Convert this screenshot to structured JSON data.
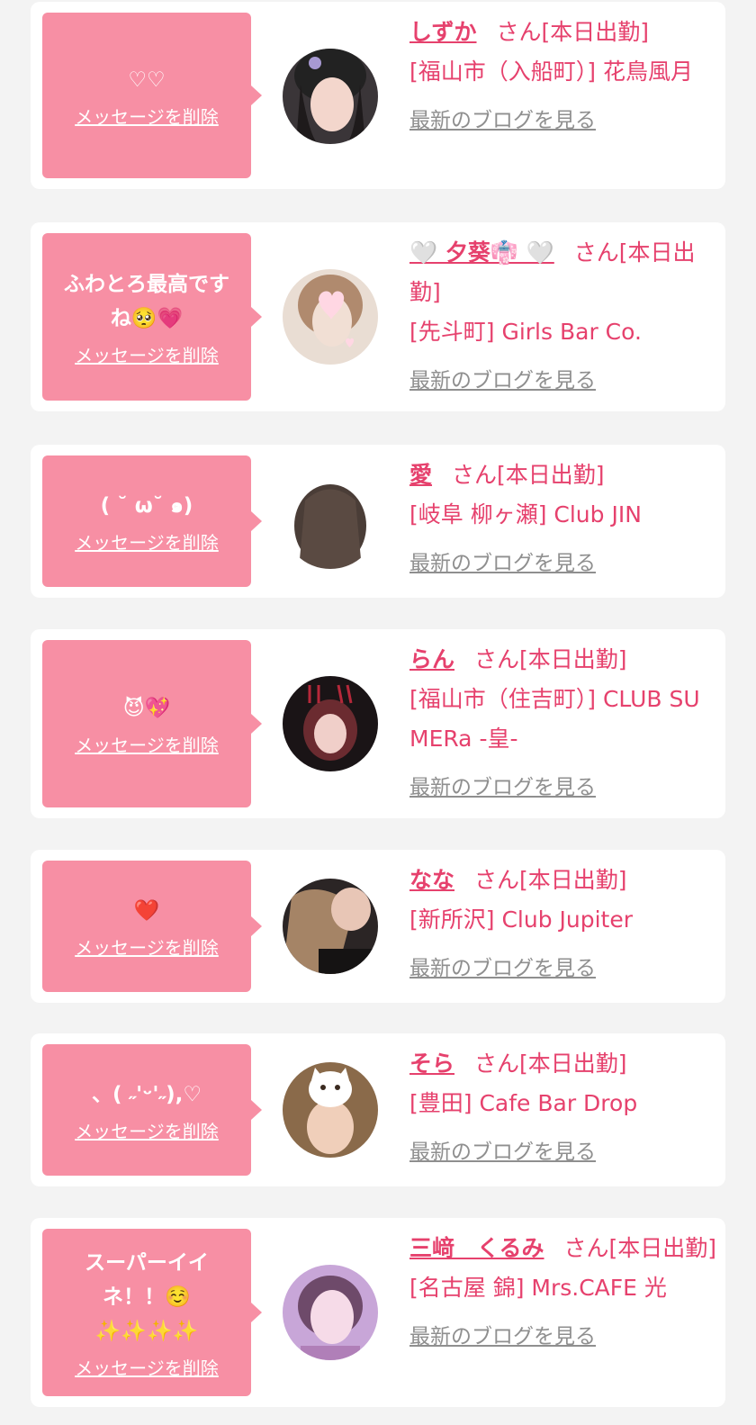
{
  "delete_label": "メッセージを削除",
  "blog_label": "最新のブログを見る",
  "items": [
    {
      "message": "♡♡",
      "name": "しずか",
      "suffix": "さん[本日出勤]",
      "shop": "[福山市（入船町）] 花鳥風月"
    },
    {
      "message": "ふわとろ最高です\nね🥺💗",
      "name": "🤍 夕葵👘 🤍",
      "suffix": "さん[本日出勤]",
      "shop": "[先斗町] Girls Bar Co."
    },
    {
      "message": "( ˘ ω˘ ๑)",
      "name": "愛",
      "suffix": "さん[本日出勤]",
      "shop": "[岐阜 柳ヶ瀬] Club JIN"
    },
    {
      "message": "😈💖",
      "name": "らん",
      "suffix": "さん[本日出勤]",
      "shop": "[福山市（住吉町）] CLUB SUMERa -皇-"
    },
    {
      "message": "❤️",
      "name": "なな",
      "suffix": "さん[本日出勤]",
      "shop": "[新所沢] Club Jupiter"
    },
    {
      "message": "、( ˶'ᵕ'˶),♡",
      "name": "そら",
      "suffix": "さん[本日出勤]",
      "shop": "[豊田] Cafe Bar Drop"
    },
    {
      "message": "スーパーイイ\nネ！！☺️\n✨✨✨✨",
      "name": "三﨑　くるみ",
      "suffix": "さん[本日出勤]",
      "shop": "[名古屋 錦] Mrs.CAFE 光"
    }
  ],
  "colors": {
    "bubble": "#f78fa4",
    "name": "#e6416d",
    "link_gray": "#8f8f8f",
    "page_bg": "#f3f3f3"
  }
}
